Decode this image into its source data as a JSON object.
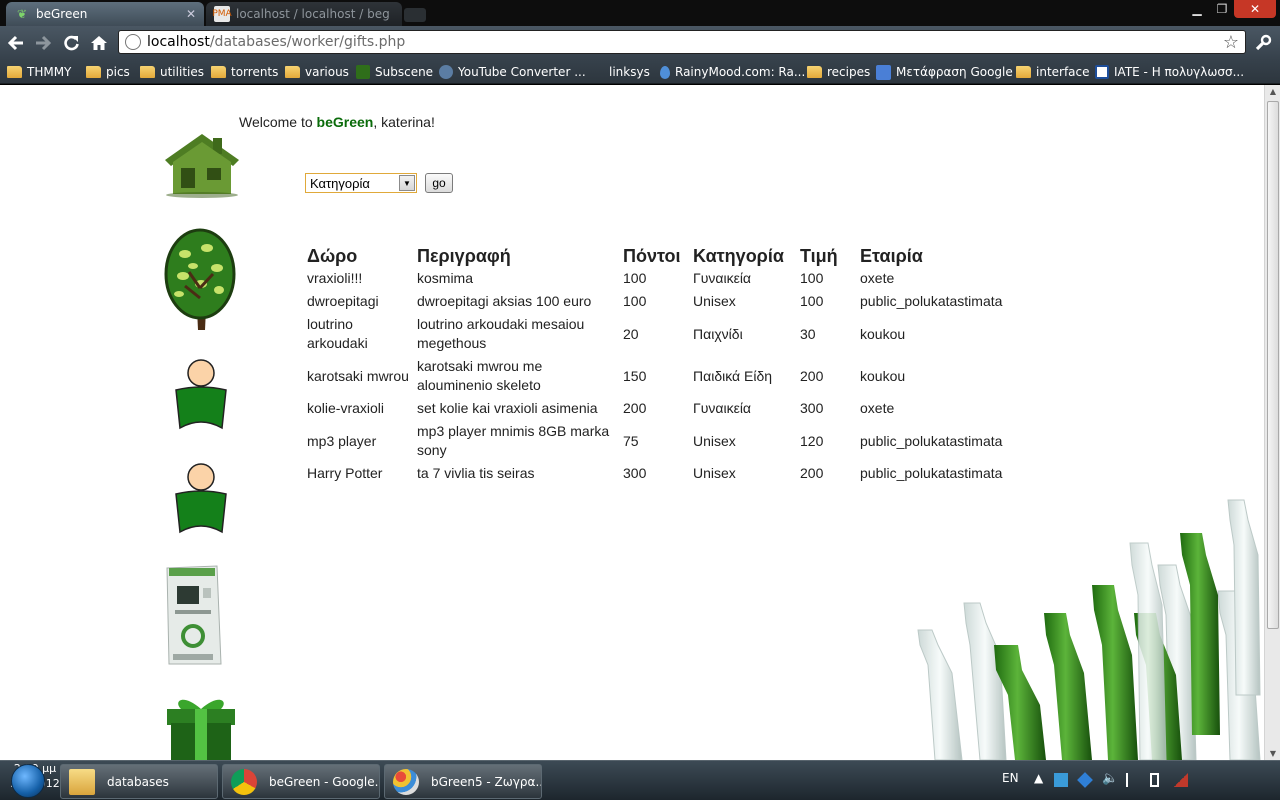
{
  "browser": {
    "tabs": [
      {
        "title": "beGreen",
        "active": true
      },
      {
        "title": "localhost / localhost / beg",
        "active": false
      }
    ],
    "address": {
      "host": "localhost",
      "path": "/databases/worker/gifts.php"
    },
    "bookmarks": [
      {
        "label": "THMMY",
        "icon": "folder-icon"
      },
      {
        "label": "pics",
        "icon": "folder-icon"
      },
      {
        "label": "utilities",
        "icon": "folder-icon"
      },
      {
        "label": "torrents",
        "icon": "folder-icon"
      },
      {
        "label": "various",
        "icon": "folder-icon"
      },
      {
        "label": "Subscene",
        "icon": "subscene-icon"
      },
      {
        "label": "YouTube Converter ...",
        "icon": "youtube-converter-icon"
      },
      {
        "label": "linksys",
        "icon": "none"
      },
      {
        "label": "RainyMood.com: Ra...",
        "icon": "raindrop-icon"
      },
      {
        "label": "recipes",
        "icon": "folder-icon"
      },
      {
        "label": "Μετάφραση Google",
        "icon": "google-translate-icon"
      },
      {
        "label": "interface",
        "icon": "folder-icon"
      },
      {
        "label": "IATE - Η πολυγλωσσ...",
        "icon": "iate-icon"
      }
    ]
  },
  "page": {
    "welcome": {
      "prefix": "Welcome to ",
      "brand": "beGreen",
      "suffix": ", katerina!"
    },
    "filter": {
      "selected": "Κατηγορία",
      "button": "go"
    },
    "table": {
      "headers": [
        "Δώρο",
        "Περιγραφή",
        "Πόντοι",
        "Κατηγορία",
        "Τιμή",
        "Εταιρία"
      ],
      "rows": [
        [
          "vraxioli!!!",
          "kosmima",
          "100",
          "Γυναικεία",
          "100",
          "oxete"
        ],
        [
          "dwroepitagi",
          "dwroepitagi aksias 100 euro",
          "100",
          "Unisex",
          "100",
          "public_polukatastimata"
        ],
        [
          "loutrino arkoudaki",
          "loutrino arkoudaki mesaiou megethous",
          "20",
          "Παιχνίδι",
          "30",
          "koukou"
        ],
        [
          "karotsaki mwrou",
          "karotsaki mwrou me alouminenio skeleto",
          "150",
          "Παιδικά Είδη",
          "200",
          "koukou"
        ],
        [
          "kolie-vraxioli",
          "set kolie kai vraxioli asimenia",
          "200",
          "Γυναικεία",
          "300",
          "oxete"
        ],
        [
          "mp3 player",
          "mp3 player mnimis 8GB marka sony",
          "75",
          "Unisex",
          "120",
          "public_polukatastimata"
        ],
        [
          "Harry Potter",
          "ta 7 vivlia tis seiras",
          "300",
          "Unisex",
          "200",
          "public_polukatastimata"
        ]
      ]
    },
    "sidebar_icons": [
      "house-icon",
      "tree-icon",
      "person-icon",
      "person-icon",
      "recycle-machine-icon",
      "gift-icon"
    ]
  },
  "taskbar": {
    "items": [
      "databases",
      "beGreen - Google...",
      "bGreen5 - Ζωγρα..."
    ],
    "language": "EN",
    "time": "2:10 μμ",
    "date": "5/3/2012"
  },
  "colors": {
    "brand_green": "#0a6b0a",
    "select_border": "#e0a93a"
  }
}
